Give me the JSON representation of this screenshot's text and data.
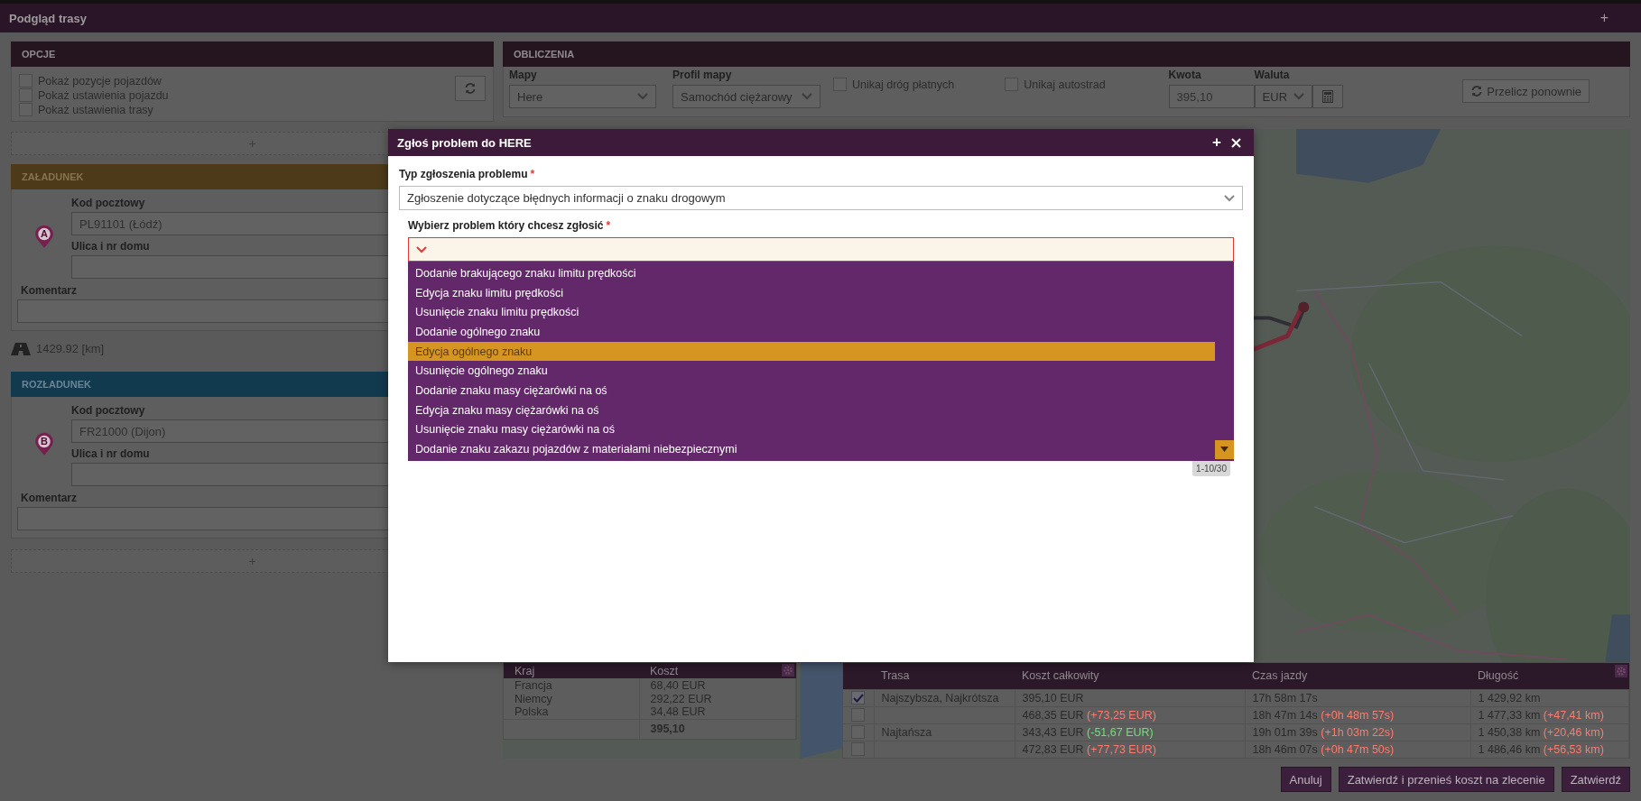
{
  "window": {
    "title": "Podgląd trasy",
    "action": "+"
  },
  "options": {
    "title": "OPCJE",
    "checkboxes": [
      {
        "label": "Pokaż pozycje pojazdów",
        "checked": false
      },
      {
        "label": "Pokaż ustawienia pojazdu",
        "checked": false
      },
      {
        "label": "Pokaż ustawienia trasy",
        "checked": false
      }
    ],
    "add": "+"
  },
  "stops": [
    {
      "kind": "loading",
      "title": "ZAŁADUNEK",
      "marker": "A",
      "postal_label": "Kod pocztowy",
      "postal": "PL91101 (Łódź)",
      "street_label": "Ulica i nr domu",
      "comment_label": "Komentarz",
      "distance": "1429.92 [km]"
    },
    {
      "kind": "unloading",
      "title": "ROZŁADUNEK",
      "marker": "B",
      "postal_label": "Kod pocztowy",
      "postal": "FR21000 (Dijon)",
      "street_label": "Ulica i nr domu",
      "comment_label": "Komentarz"
    }
  ],
  "add_stop": "+",
  "calculation": {
    "title": "OBLICZENIA",
    "maps": {
      "label": "Mapy",
      "value": "Here"
    },
    "profile": {
      "label": "Profil mapy",
      "value": "Samochód ciężarowy"
    },
    "avoid": [
      {
        "label": "Unikaj dróg płatnych",
        "checked": false
      },
      {
        "label": "Unikaj autostrad",
        "checked": false
      }
    ],
    "amount": {
      "label": "Kwota",
      "value": "395,10"
    },
    "currency": {
      "label": "Waluta",
      "value": "EUR"
    },
    "recalculate": "Przelicz ponownie"
  },
  "map": {
    "kind": "picture"
  },
  "country_costs": {
    "columns": [
      "Kraj",
      "Koszt"
    ],
    "rows": [
      {
        "country": "Francja",
        "cost": "68,40 EUR"
      },
      {
        "country": "Niemcy",
        "cost": "292,22 EUR"
      },
      {
        "country": "Polska",
        "cost": "34,48 EUR"
      }
    ],
    "total": "395,10"
  },
  "routes": {
    "columns": [
      "Trasa",
      "Koszt całkowity",
      "Czas jazdy",
      "Długość"
    ],
    "rows": [
      {
        "checked": true,
        "name": "Najszybsza, Najkrótsza",
        "cost": {
          "value": "395,10 EUR"
        },
        "time": {
          "value": "17h 58m 17s"
        },
        "length": {
          "value": "1 429,92 km"
        }
      },
      {
        "checked": false,
        "cost": {
          "value": "468,35 EUR",
          "delta": "(+73,25 EUR)",
          "color": "#ff7a6e"
        },
        "time": {
          "value": "18h 47m 14s",
          "delta": "(+0h 48m 57s)",
          "color": "#ff7a6e"
        },
        "length": {
          "value": "1 477,33 km",
          "delta": "(+47,41 km)",
          "color": "#ff7a6e"
        }
      },
      {
        "checked": false,
        "name": "Najtańsza",
        "cost": {
          "value": "343,43 EUR",
          "delta": "(-51,67 EUR)",
          "color": "#6ee07a"
        },
        "time": {
          "value": "19h 01m 39s",
          "delta": "(+1h 03m 22s)",
          "color": "#ff7a6e"
        },
        "length": {
          "value": "1 450,38 km",
          "delta": "(+20,46 km)",
          "color": "#ff7a6e"
        }
      },
      {
        "checked": false,
        "cost": {
          "value": "472,83 EUR",
          "delta": "(+77,73 EUR)",
          "color": "#ff7a6e"
        },
        "time": {
          "value": "18h 46m 07s",
          "delta": "(+0h 47m 50s)",
          "color": "#ff7a6e"
        },
        "length": {
          "value": "1 486,46 km",
          "delta": "(+56,53 km)",
          "color": "#ff7a6e"
        }
      }
    ]
  },
  "buttons": [
    "Anuluj",
    "Zatwierdź i przenieś koszt na zlecenie",
    "Zatwierdź"
  ],
  "dialog": {
    "title": "Zgłoś problem do HERE",
    "type_field": {
      "label": "Typ zgłoszenia problemu",
      "required_mark": "*",
      "value": "Zgłoszenie dotyczące błędnych informacji o znaku drogowym"
    },
    "problem_field": {
      "label": "Wybierz problem który chcesz zgłosić",
      "required_mark": "*",
      "invalid": true,
      "options": [
        {
          "label": "Dodanie brakującego znaku limitu prędkości",
          "selected": false
        },
        {
          "label": "Edycja znaku limitu prędkości",
          "selected": false
        },
        {
          "label": "Usunięcie znaku limitu prędkości",
          "selected": false
        },
        {
          "label": "Dodanie ogólnego znaku",
          "selected": false
        },
        {
          "label": "Edycja ogólnego znaku",
          "selected": true
        },
        {
          "label": "Usunięcie ogólnego znaku",
          "selected": false
        },
        {
          "label": "Dodanie znaku masy ciężarówki na oś",
          "selected": false
        },
        {
          "label": "Edycja znaku masy ciężarówki na oś",
          "selected": false
        },
        {
          "label": "Usunięcie znaku masy ciężarówki na oś",
          "selected": false
        },
        {
          "label": "Dodanie znaku zakazu pojazdów z materiałami niebezpiecznymi",
          "selected": false
        }
      ],
      "page": "1-10/30"
    }
  }
}
